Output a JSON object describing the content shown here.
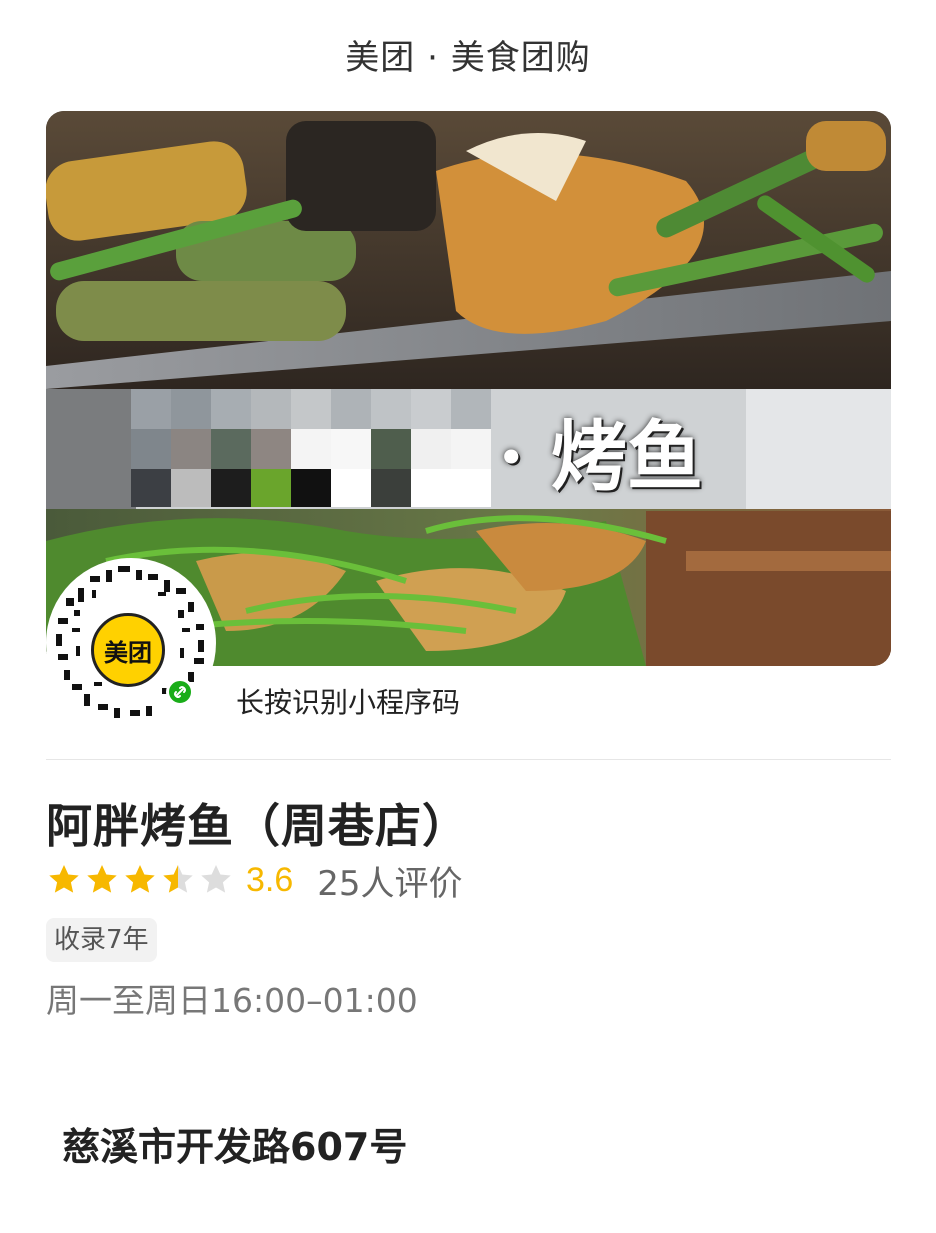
{
  "header": {
    "title": "美团 · 美食团购"
  },
  "hero": {
    "overlay_text": "· 烤鱼",
    "image_semantic": "grilled-fish-photo"
  },
  "qr": {
    "badge_text": "美团",
    "caption": "长按识别小程序码",
    "badge_color": "#ffd100",
    "link_icon_color": "#1aad19"
  },
  "store": {
    "name": "阿胖烤鱼（周巷店）",
    "rating": 3.6,
    "rating_text": "3.6",
    "review_count": "25人评价",
    "tag": "收录7年",
    "hours": "周一至周日16:00–01:00",
    "address": "慈溪市开发路607号"
  },
  "colors": {
    "star_active": "#f7b800",
    "star_inactive": "#dddddd",
    "text_primary": "#222222",
    "text_secondary": "#777777"
  }
}
